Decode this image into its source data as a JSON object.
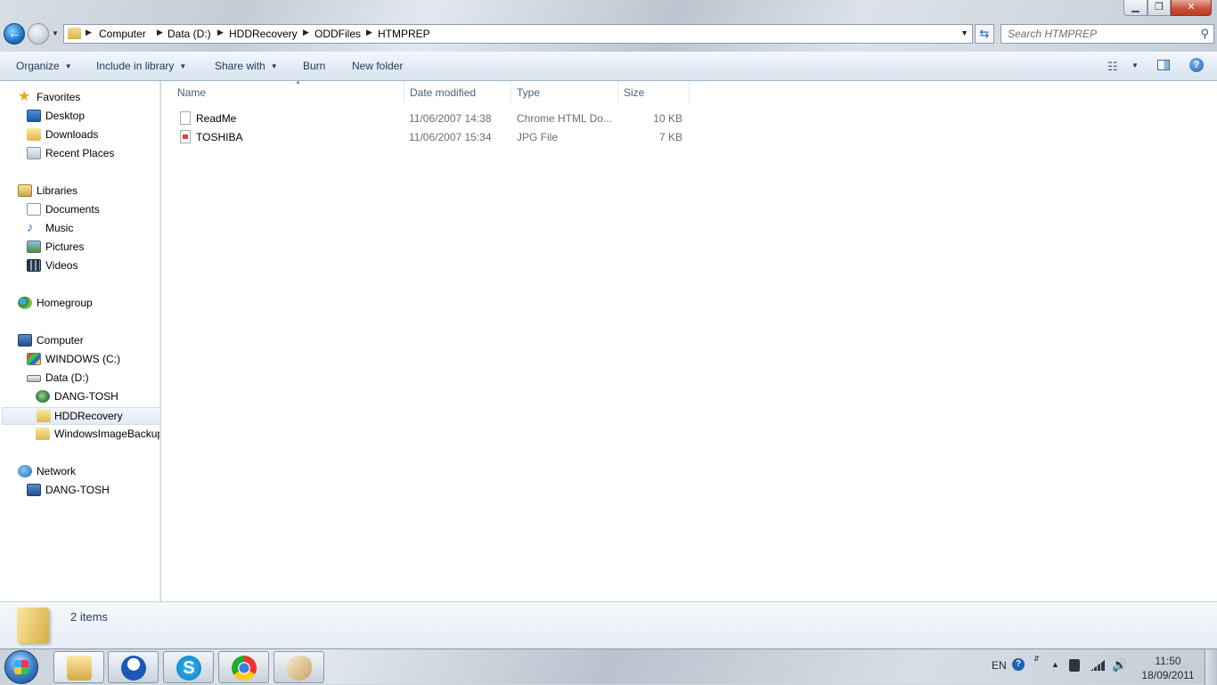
{
  "window": {
    "minimize_glyph": "▁",
    "maximize_glyph": "❐",
    "close_glyph": "✕"
  },
  "nav": {
    "back_glyph": "←",
    "forward_glyph": "→",
    "recent_glyph": "▼",
    "refresh_glyph": "⇆"
  },
  "address": {
    "crumbs": [
      "Computer",
      "Data (D:)",
      "HDDRecovery",
      "ODDFiles",
      "HTMPREP"
    ],
    "separator": "▶",
    "dropdown_glyph": "▼"
  },
  "search": {
    "placeholder": "Search HTMPREP",
    "icon": "search-icon",
    "glyph": "⚲"
  },
  "toolbar": {
    "organize": "Organize",
    "include_in_library": "Include in library",
    "share_with": "Share with",
    "burn": "Burn",
    "new_folder": "New folder",
    "caret": "▼",
    "views_glyph": "☷",
    "help_glyph": "?"
  },
  "sidebar": {
    "favorites": {
      "label": "Favorites",
      "glyph": "★",
      "items": [
        "Desktop",
        "Downloads",
        "Recent Places"
      ]
    },
    "libraries": {
      "label": "Libraries",
      "items": [
        "Documents",
        "Music",
        "Pictures",
        "Videos"
      ]
    },
    "homegroup": {
      "label": "Homegroup"
    },
    "computer": {
      "label": "Computer",
      "items": [
        "WINDOWS (C:)",
        "Data (D:)"
      ],
      "data_children": [
        "DANG-TOSH",
        "HDDRecovery",
        "WindowsImageBackup"
      ]
    },
    "network": {
      "label": "Network",
      "items": [
        "DANG-TOSH"
      ]
    },
    "music_glyph": "♪"
  },
  "columns": {
    "name": "Name",
    "date_modified": "Date modified",
    "type": "Type",
    "size": "Size",
    "sort_glyph": "▲"
  },
  "files": [
    {
      "name": "ReadMe",
      "date": "11/06/2007 14:38",
      "type": "Chrome HTML Do...",
      "size": "10 KB",
      "icon": "html-file-icon"
    },
    {
      "name": "TOSHIBA",
      "date": "11/06/2007 15:34",
      "type": "JPG File",
      "size": "7 KB",
      "icon": "jpg-file-icon"
    }
  ],
  "details": {
    "item_count": "2 items"
  },
  "taskbar": {
    "language": "EN",
    "help_glyph": "?",
    "updown_glyph": "⇵",
    "show_hidden_glyph": "▲",
    "volume_glyph": "🔊",
    "skype_glyph": "S",
    "time": "11:50",
    "date": "18/09/2011",
    "apps": [
      "windows-explorer",
      "windows-live-messenger",
      "skype",
      "google-chrome",
      "paint"
    ]
  }
}
